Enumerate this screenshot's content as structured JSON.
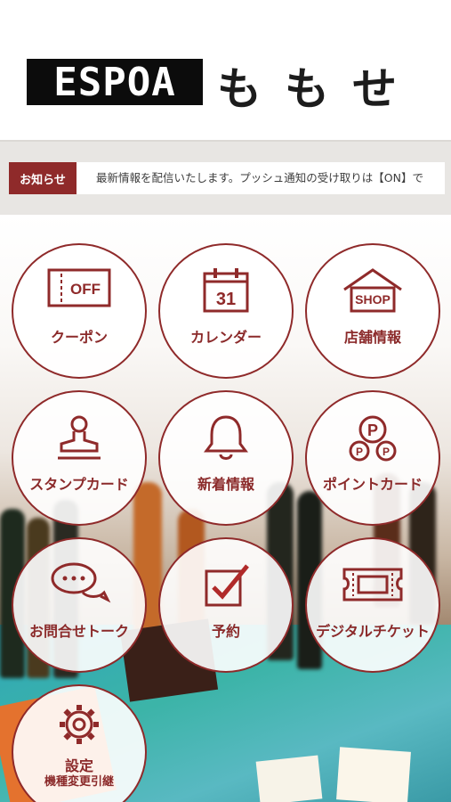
{
  "header": {
    "logo_text": "ESPOA",
    "store_name": "ももせ"
  },
  "news": {
    "badge": "お知らせ",
    "text": "最新情報を配信いたします。プッシュ通知の受け取りは【ON】で"
  },
  "menu": {
    "coupon": {
      "label": "クーポン",
      "icon": "ticket-off-icon",
      "icon_text": "OFF"
    },
    "calendar": {
      "label": "カレンダー",
      "icon": "calendar-icon",
      "icon_text": "31"
    },
    "shop": {
      "label": "店舗情報",
      "icon": "shop-house-icon",
      "icon_text": "SHOP"
    },
    "stamp": {
      "label": "スタンプカード",
      "icon": "stamp-icon"
    },
    "news": {
      "label": "新着情報",
      "icon": "bell-icon"
    },
    "point": {
      "label": "ポイントカード",
      "icon": "point-coins-icon",
      "icon_text_big": "P",
      "icon_text_small": "P"
    },
    "talk": {
      "label": "お問合せトーク",
      "icon": "chat-bubbles-icon"
    },
    "reserve": {
      "label": "予約",
      "icon": "checkbox-icon"
    },
    "ticket": {
      "label": "デジタルチケット",
      "icon": "ticket-icon"
    },
    "settings": {
      "label": "設定",
      "sublabel": "機種変更引継",
      "icon": "gear-icon"
    }
  },
  "colors": {
    "accent": "#8f2a2a",
    "news_bar": "#e8e6e3"
  }
}
